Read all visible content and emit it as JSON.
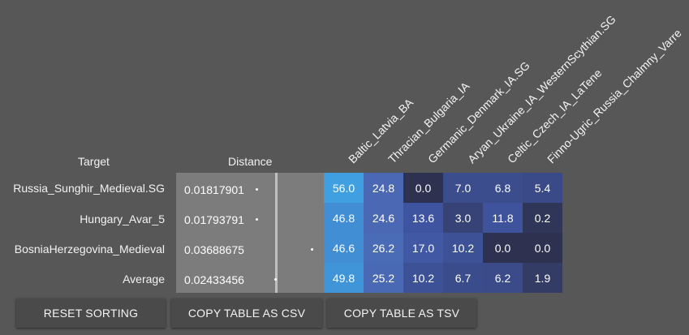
{
  "headers": {
    "target": "Target",
    "distance": "Distance"
  },
  "columns": [
    "Baltic_Latvia_BA",
    "Thracian_Bulgaria_IA",
    "Germanic_Denmark_IA.SG",
    "Aryan_Ukraine_IA_WesternScythian.SG",
    "Celtic_Czech_IA_LaTene",
    "Finno-Ugric_Russia_Chalmny_Varre"
  ],
  "rows": [
    {
      "target": "Russia_Sunghir_Medieval.SG",
      "distance": "0.01817901",
      "values": [
        "56.0",
        "24.8",
        "0.0",
        "7.0",
        "6.8",
        "5.4"
      ]
    },
    {
      "target": "Hungary_Avar_5",
      "distance": "0.01793791",
      "values": [
        "46.8",
        "24.6",
        "13.6",
        "3.0",
        "11.8",
        "0.2"
      ]
    },
    {
      "target": "BosniaHerzegovina_Medieval",
      "distance": "0.03688675",
      "values": [
        "46.6",
        "26.2",
        "17.0",
        "10.2",
        "0.0",
        "0.0"
      ]
    },
    {
      "target": "Average",
      "distance": "0.02433456",
      "values": [
        "49.8",
        "25.2",
        "10.2",
        "6.7",
        "6.2",
        "1.9"
      ]
    }
  ],
  "buttons": {
    "reset": "RESET SORTING",
    "csv": "COPY TABLE AS CSV",
    "tsv": "COPY TABLE AS TSV"
  },
  "colors": {
    "cell_high": "#3f9fe0",
    "cell_mid": "#4a68b3",
    "cell_low": "#3a4b8f",
    "cell_zero": "#2e3250",
    "distance_bg": "#7c7c7c",
    "button_bg": "#4a4a4a"
  }
}
